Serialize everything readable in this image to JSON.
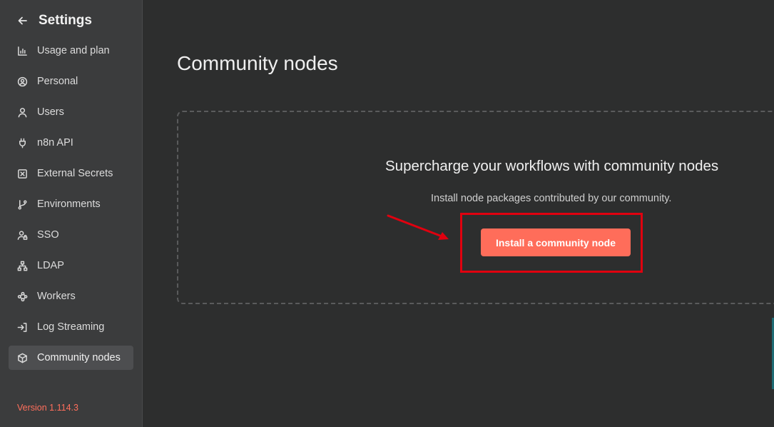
{
  "sidebar": {
    "title": "Settings",
    "items": [
      {
        "label": "Usage and plan",
        "icon": "bar-chart-icon"
      },
      {
        "label": "Personal",
        "icon": "user-circle-icon"
      },
      {
        "label": "Users",
        "icon": "user-icon"
      },
      {
        "label": "n8n API",
        "icon": "plug-icon"
      },
      {
        "label": "External Secrets",
        "icon": "vault-icon"
      },
      {
        "label": "Environments",
        "icon": "git-branch-icon"
      },
      {
        "label": "SSO",
        "icon": "user-lock-icon"
      },
      {
        "label": "LDAP",
        "icon": "network-icon"
      },
      {
        "label": "Workers",
        "icon": "workers-icon"
      },
      {
        "label": "Log Streaming",
        "icon": "sign-in-icon"
      },
      {
        "label": "Community nodes",
        "icon": "cube-icon",
        "active": true
      }
    ],
    "version": "Version 1.114.3"
  },
  "main": {
    "title": "Community nodes",
    "empty_state": {
      "heading": "Supercharge your workflows with community nodes",
      "description": "Install node packages contributed by our community.",
      "button_label": "Install a community node"
    }
  },
  "colors": {
    "accent": "#ff6d5a",
    "annotation": "#e0000f",
    "sidebar_bg": "#3b3c3d",
    "main_bg": "#2d2e2e"
  }
}
